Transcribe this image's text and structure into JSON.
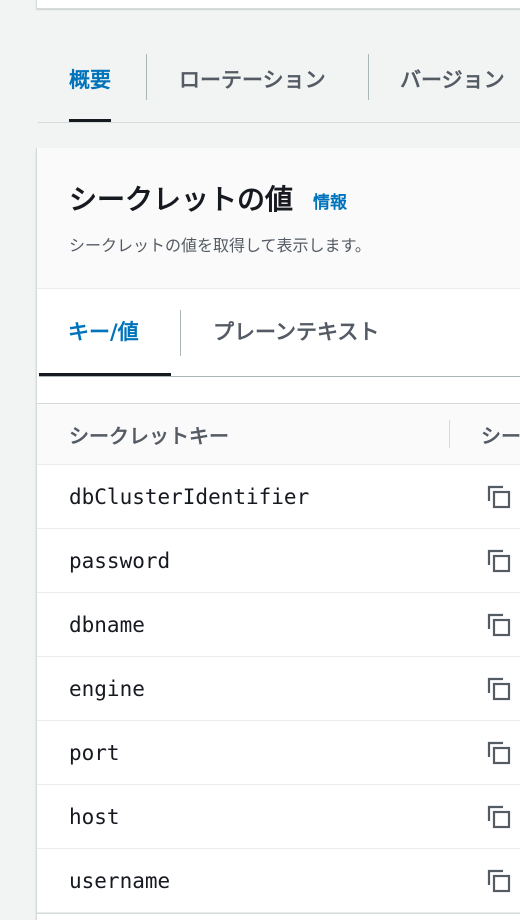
{
  "tabs": [
    "概要",
    "ローテーション",
    "バージョン"
  ],
  "panel": {
    "title": "シークレットの値",
    "info": "情報",
    "description": "シークレットの値を取得して表示します。"
  },
  "subtabs": [
    "キー/値",
    "プレーンテキスト"
  ],
  "table": {
    "columns": [
      "シークレットキー",
      "シー"
    ],
    "rows": [
      "dbClusterIdentifier",
      "password",
      "dbname",
      "engine",
      "port",
      "host",
      "username"
    ]
  },
  "colors": {
    "accent": "#0073bb",
    "text": "#16191f",
    "muted": "#545b64",
    "background": "#f2f3f3"
  },
  "icons": {
    "copy": "copy-icon"
  }
}
